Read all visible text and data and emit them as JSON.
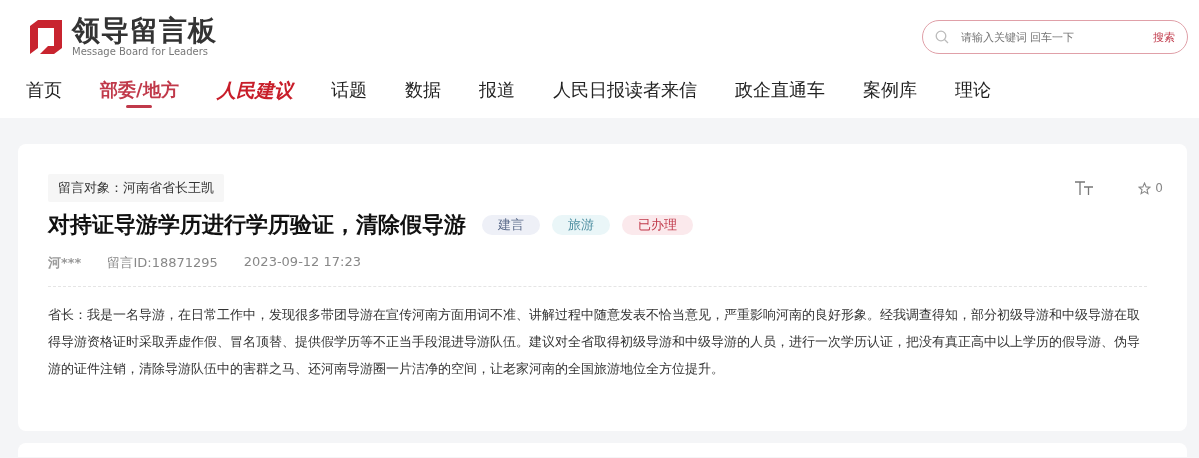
{
  "logo": {
    "title": "领导留言板",
    "subtitle": "Message Board for Leaders"
  },
  "search": {
    "placeholder": "请输入关键词 回车一下",
    "button": "搜索"
  },
  "nav": [
    {
      "label": "首页",
      "selected": false,
      "kind": "text"
    },
    {
      "label": "部委/地方",
      "selected": true,
      "kind": "text"
    },
    {
      "label": "人民建议",
      "selected": false,
      "kind": "logo"
    },
    {
      "label": "话题",
      "selected": false,
      "kind": "text"
    },
    {
      "label": "数据",
      "selected": false,
      "kind": "text"
    },
    {
      "label": "报道",
      "selected": false,
      "kind": "text"
    },
    {
      "label": "人民日报读者来信",
      "selected": false,
      "kind": "text"
    },
    {
      "label": "政企直通车",
      "selected": false,
      "kind": "text"
    },
    {
      "label": "案例库",
      "selected": false,
      "kind": "text"
    },
    {
      "label": "理论",
      "selected": false,
      "kind": "text"
    }
  ],
  "message": {
    "recipient": "留言对象：河南省省长王凯",
    "favorites": "0",
    "title": "对持证导游学历进行学历验证，清除假导游",
    "tags": [
      {
        "label": "建言",
        "color": "#eef0f7"
      },
      {
        "label": "旅游",
        "color": "#eaf6f8"
      },
      {
        "label": "已办理",
        "color": "#fbe9ec"
      }
    ],
    "author": "河***",
    "id": "留言ID:18871295",
    "date": "2023-09-12 17:23",
    "body": "省长：我是一名导游，在日常工作中，发现很多带团导游在宣传河南方面用词不准、讲解过程中随意发表不恰当意见，严重影响河南的良好形象。经我调查得知，部分初级导游和中级导游在取得导游资格证时采取弄虚作假、冒名顶替、提供假学历等不正当手段混进导游队伍。建议对全省取得初级导游和中级导游的人员，进行一次学历认证，把没有真正高中以上学历的假导游、伪导游的证件注销，清除导游队伍中的害群之马、还河南导游圈一片洁净的空间，让老家河南的全国旅游地位全方位提升。"
  }
}
